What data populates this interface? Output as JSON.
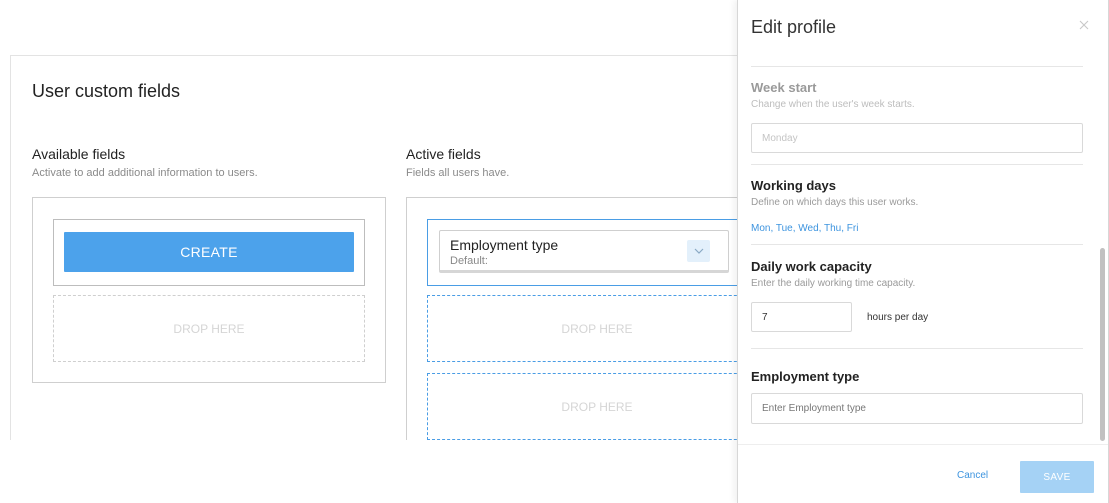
{
  "page": {
    "title": "User custom fields",
    "available": {
      "title": "Available fields",
      "subtitle": "Activate to add additional information to users.",
      "create_label": "CREATE",
      "drop_label": "DROP HERE"
    },
    "active": {
      "title": "Active fields",
      "subtitle": "Fields all users have.",
      "field_name": "Employment type",
      "field_default": "Default:",
      "drop_label_1": "DROP HERE",
      "drop_label_2": "DROP HERE"
    }
  },
  "drawer": {
    "title": "Edit profile",
    "week_start": {
      "title": "Week start",
      "description": "Change when the user's week starts.",
      "value": "Monday"
    },
    "working_days": {
      "title": "Working days",
      "description": "Define on which days this user works.",
      "link": "Mon, Tue, Wed, Thu, Fri"
    },
    "capacity": {
      "title": "Daily work capacity",
      "description": "Enter the daily working time capacity.",
      "value": "7",
      "unit": "hours per day"
    },
    "employment_type": {
      "title": "Employment type",
      "placeholder": "Enter Employment type"
    },
    "cancel_label": "Cancel",
    "save_label": "SAVE"
  },
  "colors": {
    "accent": "#4ca2eb",
    "accent_disabled": "#a5d2f5",
    "link": "#3d94df",
    "drop_active_border": "#4a9de5"
  },
  "icons": {
    "close": "close-icon",
    "chevron": "chevron-down-icon"
  }
}
